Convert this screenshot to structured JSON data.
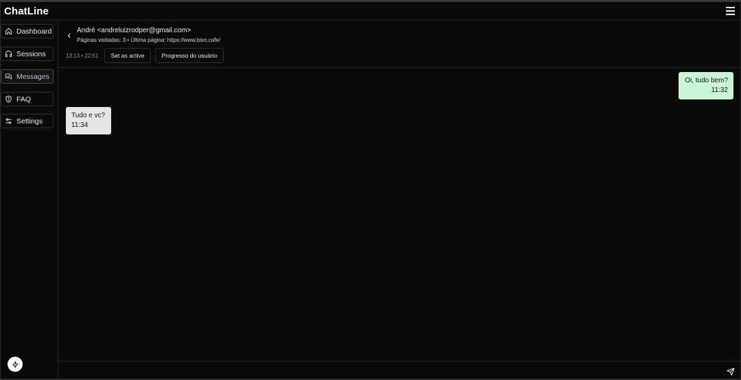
{
  "app": {
    "title": "ChatLine"
  },
  "sidebar": {
    "items": [
      {
        "label": "Dashboard",
        "icon": "home-icon"
      },
      {
        "label": "Sessions",
        "icon": "headphones-icon"
      },
      {
        "label": "Messages",
        "icon": "messages-icon",
        "active": true
      },
      {
        "label": "FAQ",
        "icon": "shield-icon"
      },
      {
        "label": "Settings",
        "icon": "sliders-icon"
      }
    ]
  },
  "header": {
    "contact": "André <andreluizrodper@gmail.com>",
    "meta": "Páginas visitadas: 3 • Última página: https://www.bixo.cafe/",
    "times": "13:13 • 22:51",
    "set_active_label": "Set as active",
    "progress_label": "Progresso do usuário"
  },
  "messages": [
    {
      "direction": "out",
      "text": "Oi, tudo bem?",
      "time": "11:32"
    },
    {
      "direction": "in",
      "text": "Tudo e vc?",
      "time": "11:34"
    }
  ],
  "composer": {
    "placeholder": ""
  },
  "colors": {
    "background": "#0a0a0a",
    "outgoing_bubble": "#c7f5d6",
    "incoming_bubble": "#e6e6e6",
    "active_nav_text": "#b8c8d8"
  }
}
